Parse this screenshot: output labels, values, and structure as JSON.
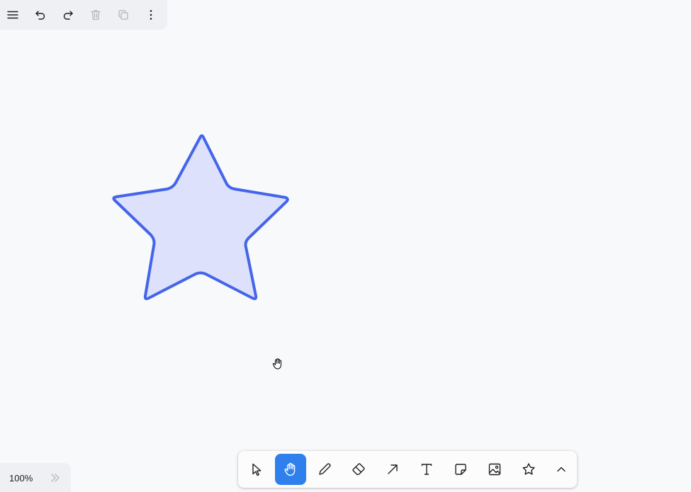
{
  "top_bar": {
    "buttons": [
      {
        "id": "menu",
        "icon": "hamburger-menu-icon",
        "enabled": true
      },
      {
        "id": "undo",
        "icon": "undo-icon",
        "enabled": true
      },
      {
        "id": "redo",
        "icon": "redo-icon",
        "enabled": true
      },
      {
        "id": "delete",
        "icon": "trash-icon",
        "enabled": false
      },
      {
        "id": "duplicate",
        "icon": "duplicate-icon",
        "enabled": false
      },
      {
        "id": "more",
        "icon": "more-vertical-icon",
        "enabled": true
      }
    ]
  },
  "canvas": {
    "shapes": [
      {
        "type": "star",
        "stroke": "#4465e9",
        "fill": "#dde1fb"
      }
    ],
    "cursor": "hand-cursor-icon"
  },
  "toolbar": {
    "active_tool": "hand",
    "active_color": "#2f80ed",
    "tools": [
      {
        "id": "select",
        "icon": "pointer-icon"
      },
      {
        "id": "hand",
        "icon": "hand-icon"
      },
      {
        "id": "draw",
        "icon": "pencil-icon"
      },
      {
        "id": "eraser",
        "icon": "eraser-icon"
      },
      {
        "id": "arrow",
        "icon": "arrow-icon"
      },
      {
        "id": "text",
        "icon": "text-icon"
      },
      {
        "id": "note",
        "icon": "sticky-note-icon"
      },
      {
        "id": "media",
        "icon": "image-icon"
      },
      {
        "id": "shape",
        "icon": "star-icon"
      },
      {
        "id": "more-tools",
        "icon": "chevron-up-icon"
      }
    ]
  },
  "zoom": {
    "label": "100%",
    "expand_icon": "double-chevron-right-icon"
  }
}
